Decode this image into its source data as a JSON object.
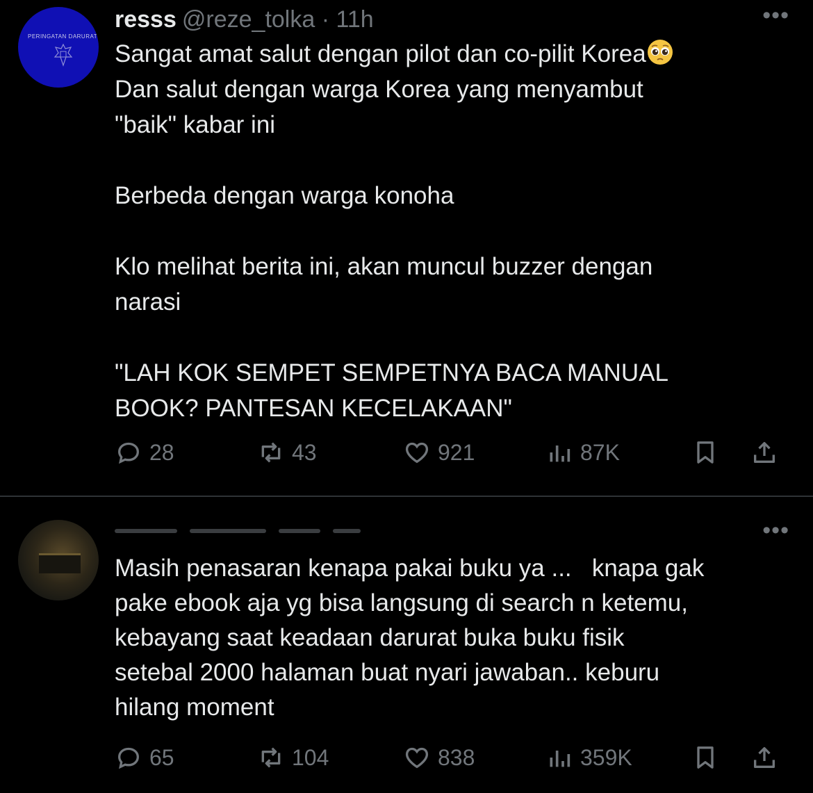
{
  "colors": {
    "background": "#000000",
    "text": "#e7e9ea",
    "muted": "#71767b",
    "divider": "#2f3336"
  },
  "tweets": [
    {
      "avatar": {
        "label": "PERINGATAN DARURAT"
      },
      "name": "resss",
      "handle": "@reze_tolka · 11h",
      "more": "•••",
      "body": "Sangat amat salut dengan pilot dan co-pilit Korea",
      "emoji": "pleading-face",
      "body_rest": "\nDan salut dengan warga Korea yang menyambut\n\"baik\" kabar ini\n\nBerbeda dengan warga konoha\n\nKlo melihat berita ini, akan muncul buzzer dengan\nnarasi\n\n\"LAH KOK SEMPET SEMPETNYA BACA MANUAL\nBOOK? PANTESAN KECELAKAAN\"",
      "actions": {
        "replies": "28",
        "reposts": "43",
        "likes": "921",
        "views": "87K"
      }
    },
    {
      "more": "•••",
      "body": "Masih penasaran kenapa pakai buku ya ...   knapa gak\npake ebook aja yg bisa langsung di search n ketemu,\nkebayang saat keadaan darurat buka buku fisik\nsetebal 2000 halaman buat nyari jawaban.. keburu\nhilang moment",
      "actions": {
        "replies": "65",
        "reposts": "104",
        "likes": "838",
        "views": "359K"
      }
    }
  ],
  "icons": [
    "reply-icon",
    "repost-icon",
    "like-icon",
    "views-icon",
    "bookmark-icon",
    "share-icon",
    "more-icon"
  ]
}
